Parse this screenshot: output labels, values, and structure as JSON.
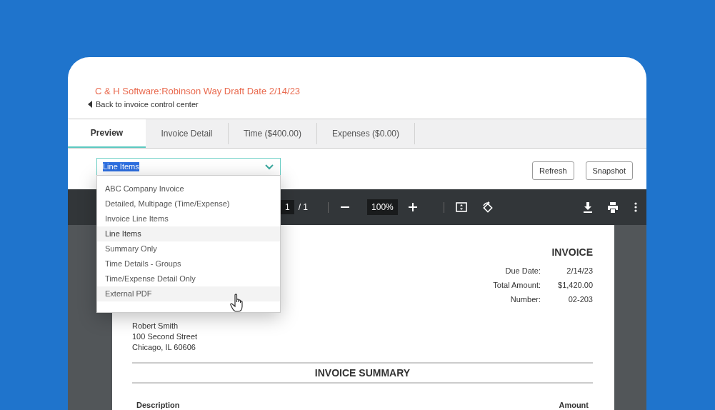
{
  "header": {
    "title": "C & H Software:Robinson Way Draft Date 2/14/23",
    "back_link": "Back to invoice control center"
  },
  "tabs": [
    {
      "label": "Preview",
      "selected": true
    },
    {
      "label": "Invoice Detail",
      "selected": false
    },
    {
      "label": "Time ($400.00)",
      "selected": false
    },
    {
      "label": "Expenses ($0.00)",
      "selected": false
    }
  ],
  "template_select": {
    "value": "Line Items",
    "open": true,
    "options": [
      {
        "label": "ABC Company Invoice",
        "selected": false,
        "hovered": false
      },
      {
        "label": "Detailed, Multipage (Time/Expense)",
        "selected": false,
        "hovered": false
      },
      {
        "label": "Invoice Line Items",
        "selected": false,
        "hovered": false
      },
      {
        "label": "Line Items",
        "selected": true,
        "hovered": false
      },
      {
        "label": "Summary Only",
        "selected": false,
        "hovered": false
      },
      {
        "label": "Time Details - Groups",
        "selected": false,
        "hovered": false
      },
      {
        "label": "Time/Expense Detail Only",
        "selected": false,
        "hovered": false
      },
      {
        "label": "External PDF",
        "selected": false,
        "hovered": true
      }
    ]
  },
  "buttons": [
    "Refresh",
    "Snapshot"
  ],
  "pdf_toolbar": {
    "page": "1",
    "page_total": "/ 1",
    "zoom": "100%"
  },
  "document": {
    "heading": "INVOICE",
    "fields": [
      {
        "label": "Due Date:",
        "value": "2/14/23"
      },
      {
        "label": "Total Amount:",
        "value": "$1,420.00"
      },
      {
        "label": "Number:",
        "value": "02-203"
      }
    ],
    "address": [
      "Robert Smith",
      "100 Second Street",
      "Chicago, IL 60606"
    ],
    "section_title": "INVOICE SUMMARY",
    "columns": [
      "Description",
      "Amount"
    ]
  }
}
